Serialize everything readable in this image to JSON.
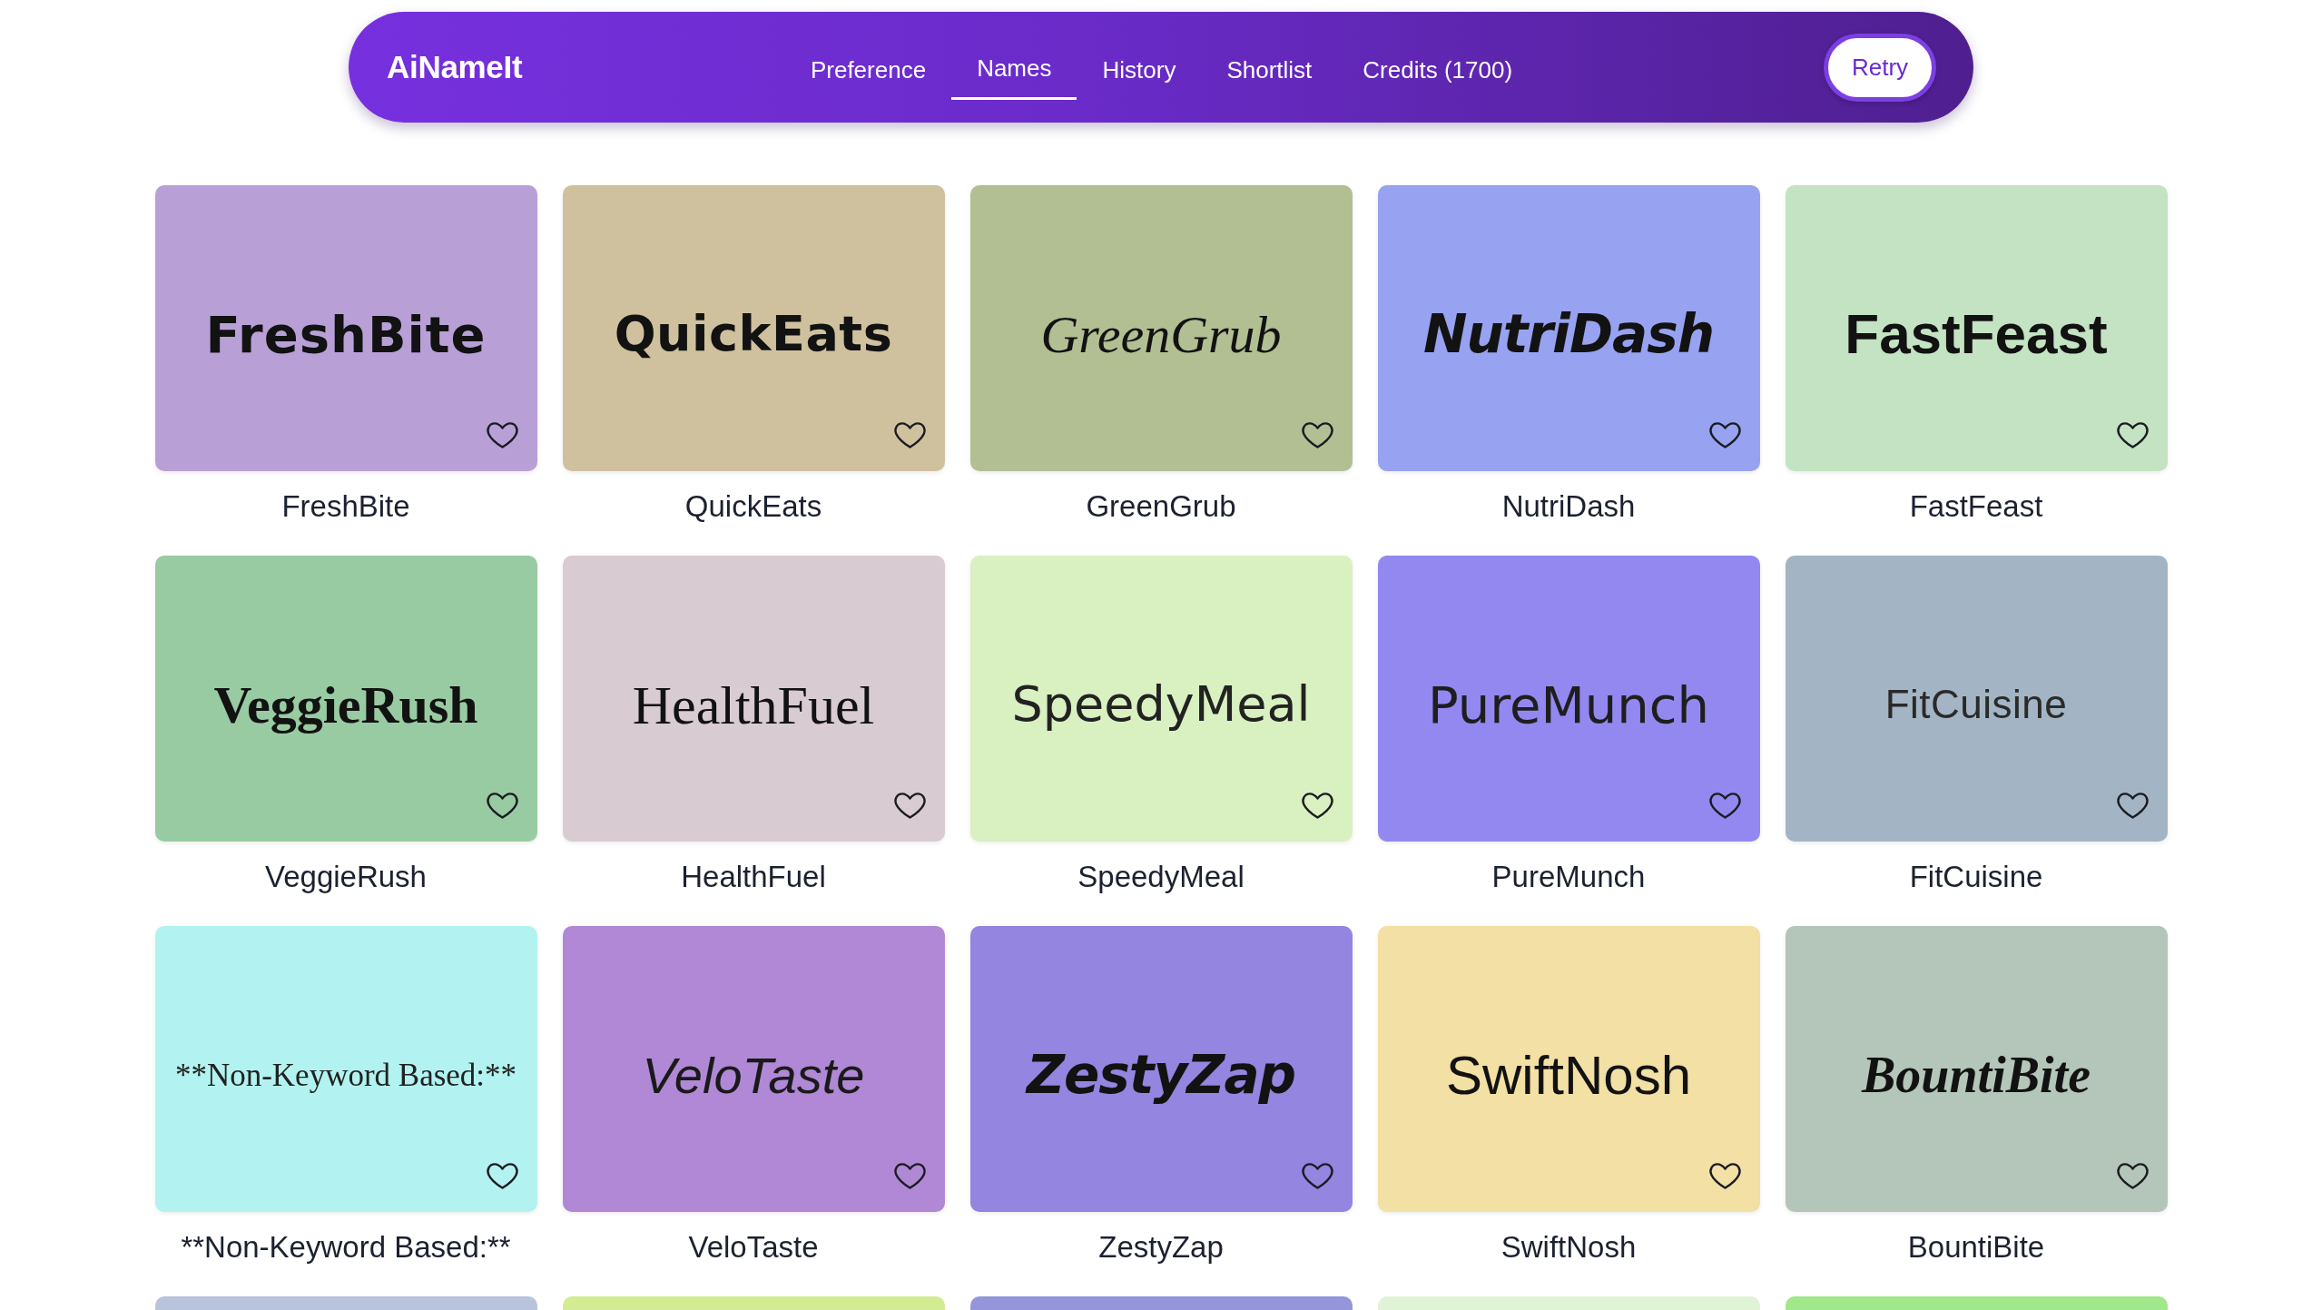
{
  "app": {
    "name": "AiNameIt"
  },
  "nav": {
    "tabs": [
      {
        "label": "Preference",
        "selected": false
      },
      {
        "label": "Names",
        "selected": true
      },
      {
        "label": "History",
        "selected": false
      },
      {
        "label": "Shortlist",
        "selected": false
      },
      {
        "label": "Credits (1700)",
        "selected": false
      }
    ],
    "retry_button": "Retry"
  },
  "names": [
    {
      "logo_text": "FreshBite",
      "label": "FreshBite",
      "color": "#b8a0d7",
      "liked": false
    },
    {
      "logo_text": "QuickEats",
      "label": "QuickEats",
      "color": "#cfc19d",
      "liked": false
    },
    {
      "logo_text": "GreenGrub",
      "label": "GreenGrub",
      "color": "#b2bf93",
      "liked": false
    },
    {
      "logo_text": "NutriDash",
      "label": "NutriDash",
      "color": "#97a2f1",
      "liked": false
    },
    {
      "logo_text": "FastFeast",
      "label": "FastFeast",
      "color": "#c3e3c3",
      "liked": false
    },
    {
      "logo_text": "VeggieRush",
      "label": "VeggieRush",
      "color": "#98cba2",
      "liked": false
    },
    {
      "logo_text": "HealthFuel",
      "label": "HealthFuel",
      "color": "#d8cbd2",
      "liked": false
    },
    {
      "logo_text": "SpeedyMeal",
      "label": "SpeedyMeal",
      "color": "#d9f0c0",
      "liked": false
    },
    {
      "logo_text": "PureMunch",
      "label": "PureMunch",
      "color": "#9388f0",
      "liked": false
    },
    {
      "logo_text": "FitCuisine",
      "label": "FitCuisine",
      "color": "#a3b5c4",
      "liked": false
    },
    {
      "logo_text": "**Non-Keyword Based:**",
      "label": "**Non-Keyword Based:**",
      "color": "#b2f3f1",
      "liked": false
    },
    {
      "logo_text": "VeloTaste",
      "label": "VeloTaste",
      "color": "#b088d6",
      "liked": false
    },
    {
      "logo_text": "ZestyZap",
      "label": "ZestyZap",
      "color": "#9385e0",
      "liked": false
    },
    {
      "logo_text": "SwiftNosh",
      "label": "SwiftNosh",
      "color": "#f2e0a4",
      "liked": false
    },
    {
      "logo_text": "BountiBite",
      "label": "BountiBite",
      "color": "#b4c6b9",
      "liked": false
    }
  ],
  "next_row": [
    {
      "color": "#b9c3dc"
    },
    {
      "color": "#d3ec92"
    },
    {
      "color": "#9595dc"
    },
    {
      "color": "#e0f3d6"
    },
    {
      "color": "#a0e88a"
    }
  ]
}
